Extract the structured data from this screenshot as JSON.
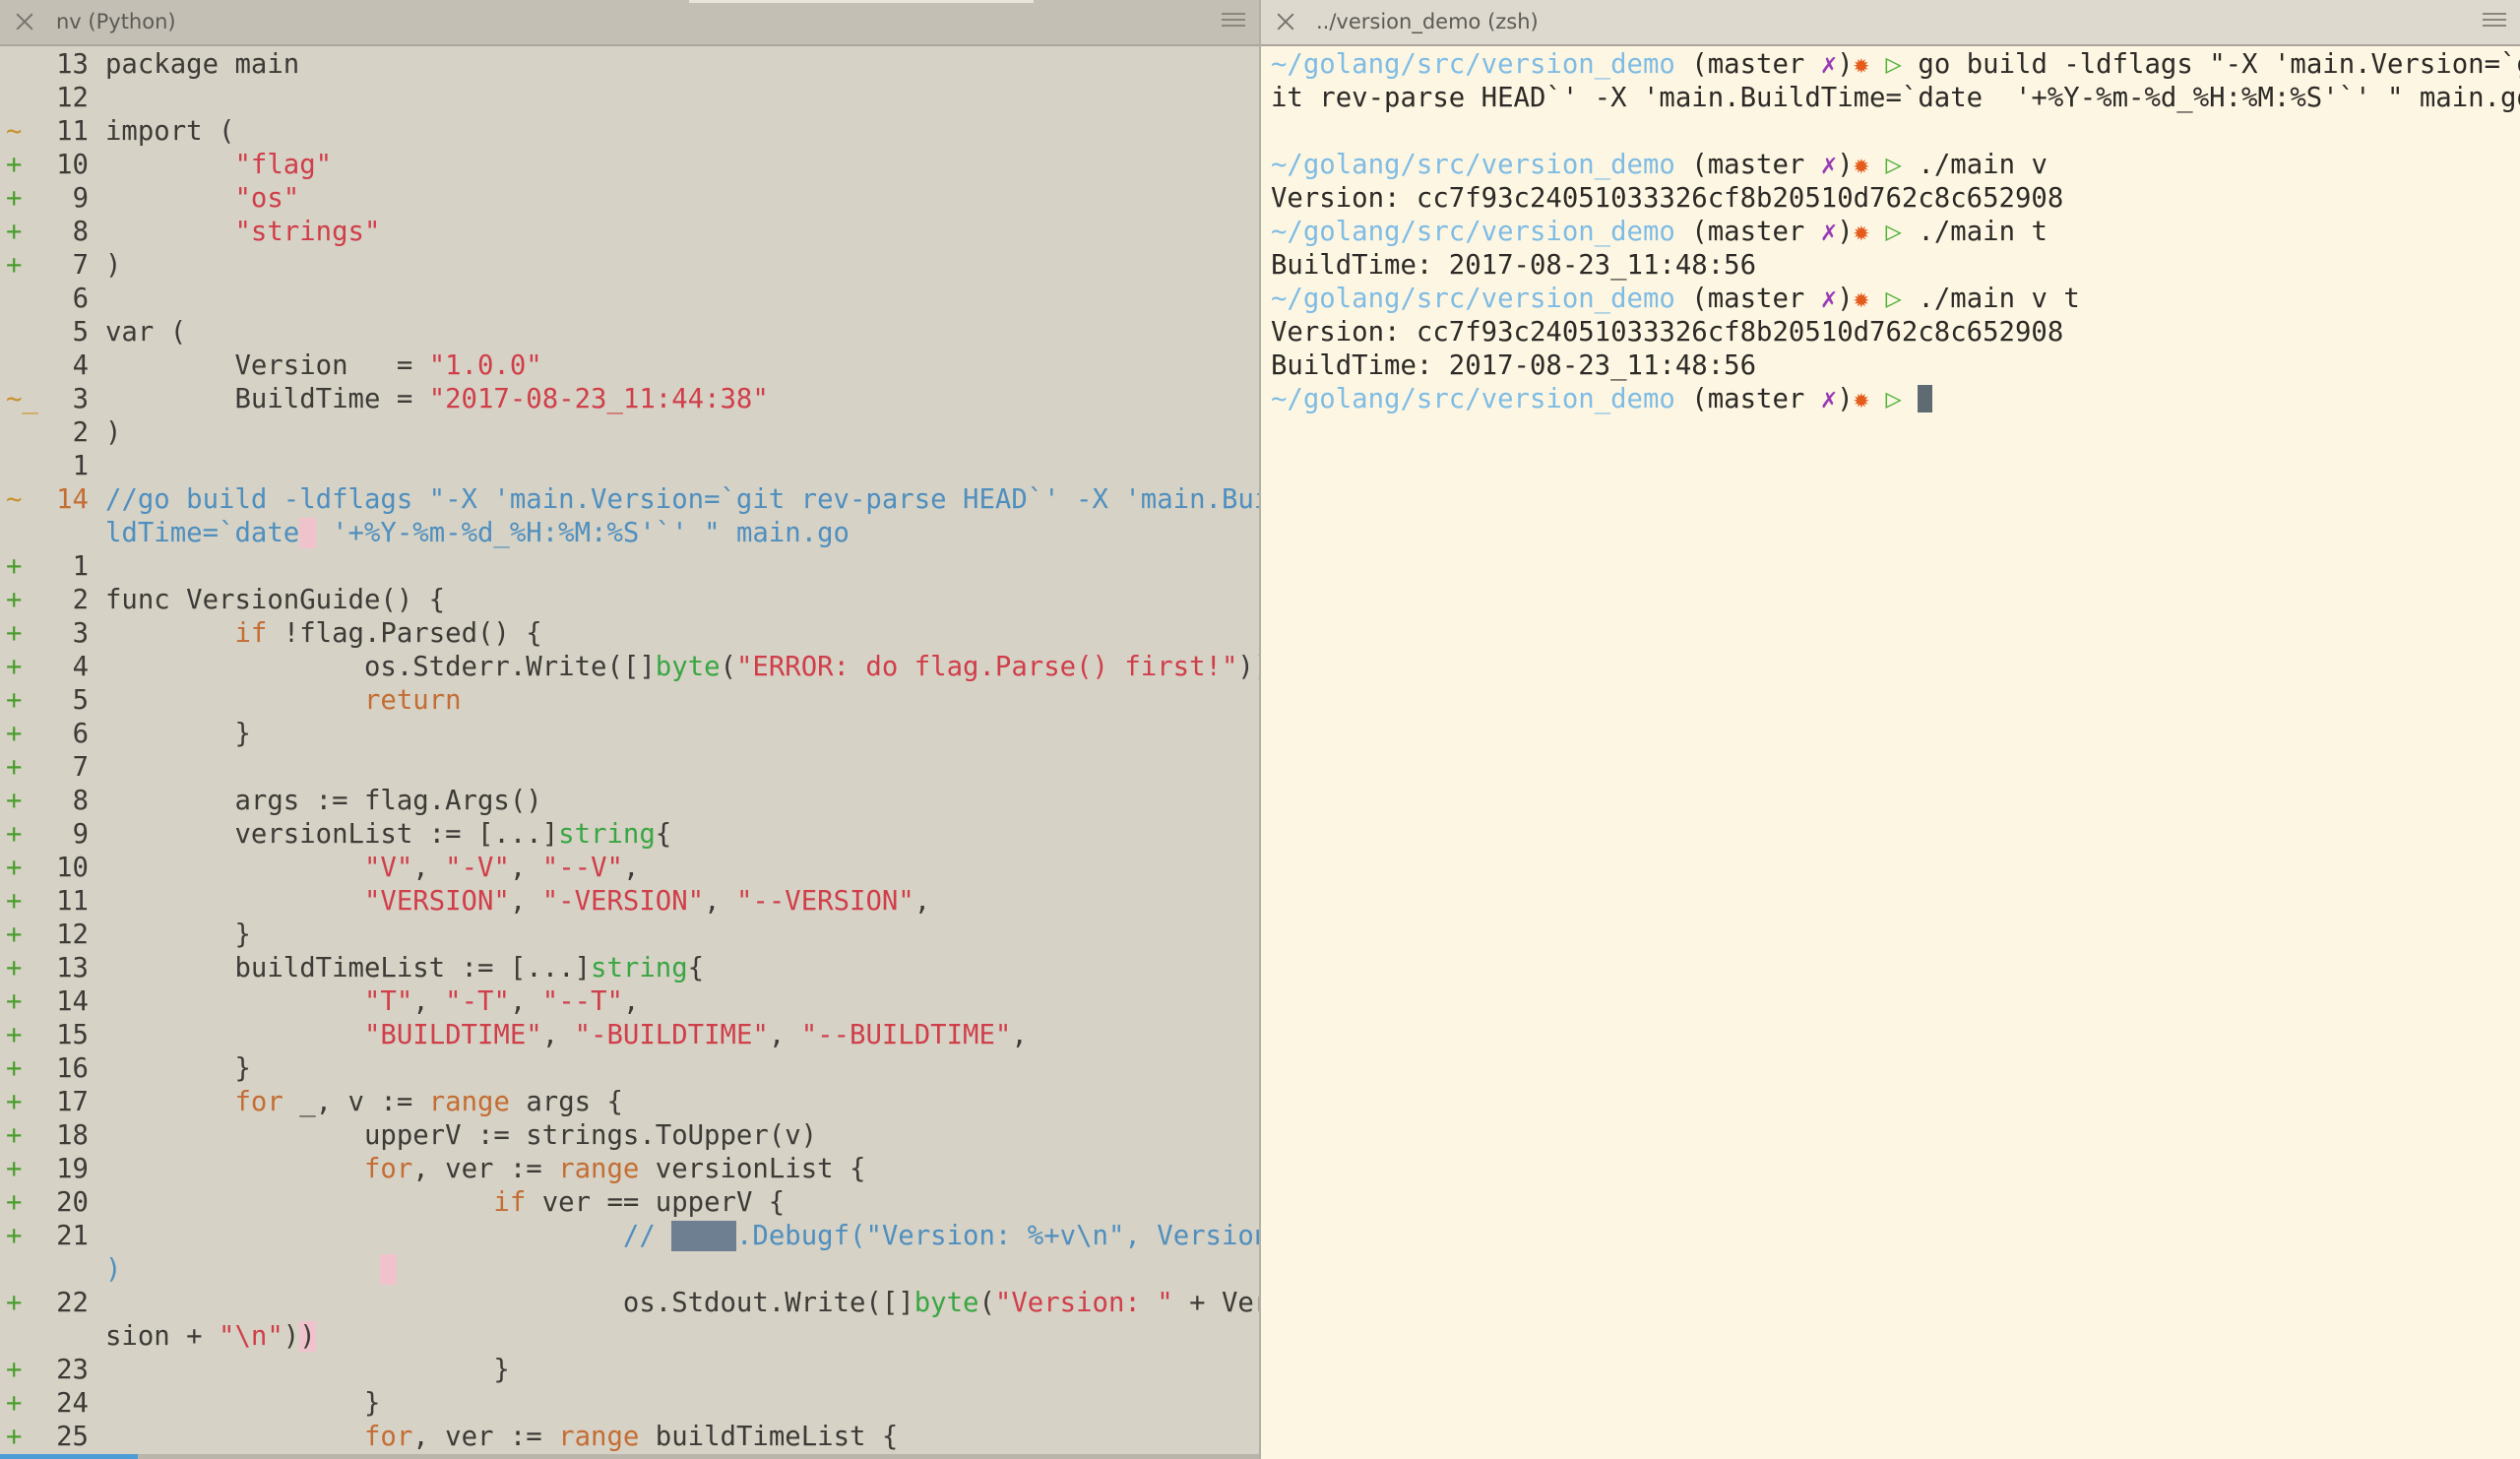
{
  "editor": {
    "tab_title": "nv (Python)",
    "lines": [
      {
        "mark": "",
        "num": "13",
        "segs": [
          [
            "",
            "package main"
          ]
        ]
      },
      {
        "mark": "",
        "num": "12",
        "segs": []
      },
      {
        "mark": "~",
        "num": "11",
        "segs": [
          [
            "",
            "import ("
          ]
        ]
      },
      {
        "mark": "+",
        "num": "10",
        "segs": [
          [
            "",
            "        "
          ],
          [
            "str",
            "\"flag\""
          ]
        ]
      },
      {
        "mark": "+",
        "num": "9",
        "segs": [
          [
            "",
            "        "
          ],
          [
            "str",
            "\"os\""
          ]
        ]
      },
      {
        "mark": "+",
        "num": "8",
        "segs": [
          [
            "",
            "        "
          ],
          [
            "str",
            "\"strings\""
          ]
        ]
      },
      {
        "mark": "+",
        "num": "7",
        "segs": [
          [
            "",
            ")"
          ]
        ]
      },
      {
        "mark": "",
        "num": "6",
        "segs": []
      },
      {
        "mark": "",
        "num": "5",
        "segs": [
          [
            "",
            "var ("
          ]
        ]
      },
      {
        "mark": "",
        "num": "4",
        "segs": [
          [
            "",
            "        Version   = "
          ],
          [
            "str",
            "\"1.0.0\""
          ]
        ]
      },
      {
        "mark": "~_",
        "num": "3",
        "segs": [
          [
            "",
            "        BuildTime = "
          ],
          [
            "str",
            "\"2017-08-23_11:44:38\""
          ]
        ]
      },
      {
        "mark": "",
        "num": "2",
        "segs": [
          [
            "",
            ")"
          ]
        ]
      },
      {
        "mark": "",
        "num": "1",
        "segs": []
      },
      {
        "mark": "~",
        "num": "14",
        "cur": true,
        "segs": [
          [
            "cmt",
            "/"
          ],
          [
            "cmt",
            "/go build -ldflags \"-X 'main.Version=`git rev-parse HEAD`' -X 'main.Bui"
          ]
        ]
      },
      {
        "mark": "",
        "num": "",
        "segs": [
          [
            "cmt",
            "ldTime=`date"
          ],
          [
            "hlbg",
            " "
          ],
          [
            "cmt",
            " '+%Y-%m-%d_%H:%M:%S'`' \" main.go"
          ]
        ]
      },
      {
        "mark": "+",
        "num": "1",
        "segs": []
      },
      {
        "mark": "+",
        "num": "2",
        "segs": [
          [
            "",
            "func VersionGuide() {"
          ]
        ]
      },
      {
        "mark": "+",
        "num": "3",
        "segs": [
          [
            "",
            "        "
          ],
          [
            "kw",
            "if"
          ],
          [
            "",
            " !flag.Parsed() {"
          ]
        ]
      },
      {
        "mark": "+",
        "num": "4",
        "segs": [
          [
            "",
            "                os.Stderr.Write([]"
          ],
          [
            "typ",
            "byte"
          ],
          [
            "",
            "("
          ],
          [
            "str",
            "\"ERROR: do flag.Parse() first!\""
          ],
          [
            "",
            "))"
          ]
        ]
      },
      {
        "mark": "+",
        "num": "5",
        "segs": [
          [
            "",
            "                "
          ],
          [
            "kw",
            "return"
          ]
        ]
      },
      {
        "mark": "+",
        "num": "6",
        "segs": [
          [
            "",
            "        }"
          ]
        ]
      },
      {
        "mark": "+",
        "num": "7",
        "segs": []
      },
      {
        "mark": "+",
        "num": "8",
        "segs": [
          [
            "",
            "        args := flag.Args()"
          ]
        ]
      },
      {
        "mark": "+",
        "num": "9",
        "segs": [
          [
            "",
            "        versionList := [...]"
          ],
          [
            "typ",
            "string"
          ],
          [
            "",
            "{"
          ]
        ]
      },
      {
        "mark": "+",
        "num": "10",
        "segs": [
          [
            "",
            "                "
          ],
          [
            "str",
            "\"V\""
          ],
          [
            "",
            ", "
          ],
          [
            "str",
            "\"-V\""
          ],
          [
            "",
            ", "
          ],
          [
            "str",
            "\"--V\""
          ],
          [
            "",
            ","
          ]
        ]
      },
      {
        "mark": "+",
        "num": "11",
        "segs": [
          [
            "",
            "                "
          ],
          [
            "str",
            "\"VERSION\""
          ],
          [
            "",
            ", "
          ],
          [
            "str",
            "\"-VERSION\""
          ],
          [
            "",
            ", "
          ],
          [
            "str",
            "\"--VERSION\""
          ],
          [
            "",
            ","
          ]
        ]
      },
      {
        "mark": "+",
        "num": "12",
        "segs": [
          [
            "",
            "        }"
          ]
        ]
      },
      {
        "mark": "+",
        "num": "13",
        "segs": [
          [
            "",
            "        buildTimeList := [...]"
          ],
          [
            "typ",
            "string"
          ],
          [
            "",
            "{"
          ]
        ]
      },
      {
        "mark": "+",
        "num": "14",
        "segs": [
          [
            "",
            "                "
          ],
          [
            "str",
            "\"T\""
          ],
          [
            "",
            ", "
          ],
          [
            "str",
            "\"-T\""
          ],
          [
            "",
            ", "
          ],
          [
            "str",
            "\"--T\""
          ],
          [
            "",
            ","
          ]
        ]
      },
      {
        "mark": "+",
        "num": "15",
        "segs": [
          [
            "",
            "                "
          ],
          [
            "str",
            "\"BUILDTIME\""
          ],
          [
            "",
            ", "
          ],
          [
            "str",
            "\"-BUILDTIME\""
          ],
          [
            "",
            ", "
          ],
          [
            "str",
            "\"--BUILDTIME\""
          ],
          [
            "",
            ","
          ]
        ]
      },
      {
        "mark": "+",
        "num": "16",
        "segs": [
          [
            "",
            "        }"
          ]
        ]
      },
      {
        "mark": "+",
        "num": "17",
        "segs": [
          [
            "",
            "        "
          ],
          [
            "kw",
            "for"
          ],
          [
            "",
            " _, v := "
          ],
          [
            "kw",
            "range"
          ],
          [
            "",
            " args {"
          ]
        ]
      },
      {
        "mark": "+",
        "num": "18",
        "segs": [
          [
            "",
            "                upperV := strings.ToUpper(v)"
          ]
        ]
      },
      {
        "mark": "+",
        "num": "19",
        "segs": [
          [
            "",
            "                "
          ],
          [
            "kw",
            "for"
          ],
          [
            "",
            ", ver := "
          ],
          [
            "kw",
            "range"
          ],
          [
            "",
            " versionList {"
          ]
        ]
      },
      {
        "mark": "+",
        "num": "20",
        "segs": [
          [
            "",
            "                        "
          ],
          [
            "kw",
            "if"
          ],
          [
            "",
            " ver == upperV {"
          ]
        ]
      },
      {
        "mark": "+",
        "num": "21",
        "segs": [
          [
            "",
            "                                "
          ],
          [
            "cmt",
            "// "
          ],
          [
            "sel",
            "glog"
          ],
          [
            "cmt",
            ".Debugf(\"Version: %+v\\n\", Version"
          ]
        ]
      },
      {
        "mark": "",
        "num": "",
        "segs": [
          [
            "cmt",
            ")"
          ],
          [
            "",
            "                "
          ],
          [
            "hlbg",
            " "
          ]
        ]
      },
      {
        "mark": "+",
        "num": "22",
        "segs": [
          [
            "",
            "                                os.Stdout.Write([]"
          ],
          [
            "typ",
            "byte"
          ],
          [
            "",
            "("
          ],
          [
            "str",
            "\"Version: \""
          ],
          [
            "",
            " + Ver"
          ]
        ]
      },
      {
        "mark": "",
        "num": "",
        "segs": [
          [
            "",
            "sion + "
          ],
          [
            "str",
            "\"\\n\""
          ],
          [
            "",
            ")"
          ],
          [
            "hlbg",
            ")"
          ]
        ]
      },
      {
        "mark": "+",
        "num": "23",
        "segs": [
          [
            "",
            "                        }"
          ]
        ]
      },
      {
        "mark": "+",
        "num": "24",
        "segs": [
          [
            "",
            "                }"
          ]
        ]
      },
      {
        "mark": "+",
        "num": "25",
        "segs": [
          [
            "",
            "                "
          ],
          [
            "kw",
            "for"
          ],
          [
            "",
            ", ver := "
          ],
          [
            "kw",
            "range"
          ],
          [
            "",
            " buildTimeList {"
          ]
        ]
      }
    ]
  },
  "terminal": {
    "tab_title": "../version_demo (zsh)",
    "prompt": {
      "path": "~/golang/src/version_demo",
      "branch_open": " (master ",
      "dirty": "✗",
      "branch_close": ")",
      "star": "✹",
      "arrow": " ▷ "
    },
    "lines": [
      {
        "type": "prompt",
        "cmd": "go build -ldflags \"-X 'main.Version=`g"
      },
      {
        "type": "out",
        "text": "it rev-parse HEAD`' -X 'main.BuildTime=`date  '+%Y-%m-%d_%H:%M:%S'`' \" main.go"
      },
      {
        "type": "out",
        "text": ""
      },
      {
        "type": "prompt",
        "cmd": "./main v"
      },
      {
        "type": "out",
        "text": "Version: cc7f93c24051033326cf8b20510d762c8c652908"
      },
      {
        "type": "prompt",
        "cmd": "./main t"
      },
      {
        "type": "out",
        "text": "BuildTime: 2017-08-23_11:48:56"
      },
      {
        "type": "prompt",
        "cmd": "./main v t"
      },
      {
        "type": "out",
        "text": "Version: cc7f93c24051033326cf8b20510d762c8c652908"
      },
      {
        "type": "out",
        "text": "BuildTime: 2017-08-23_11:48:56"
      },
      {
        "type": "prompt",
        "cmd": "",
        "cursor": true
      }
    ]
  },
  "colors": {
    "editor_bg": "#d6d2c5",
    "terminal_bg": "#fdf6e3",
    "path": "#7fbce4",
    "string": "#d03e4a",
    "keyword": "#c46d34",
    "type": "#3aa644",
    "comment": "#4f8fbf",
    "added": "#4a9d2e"
  }
}
